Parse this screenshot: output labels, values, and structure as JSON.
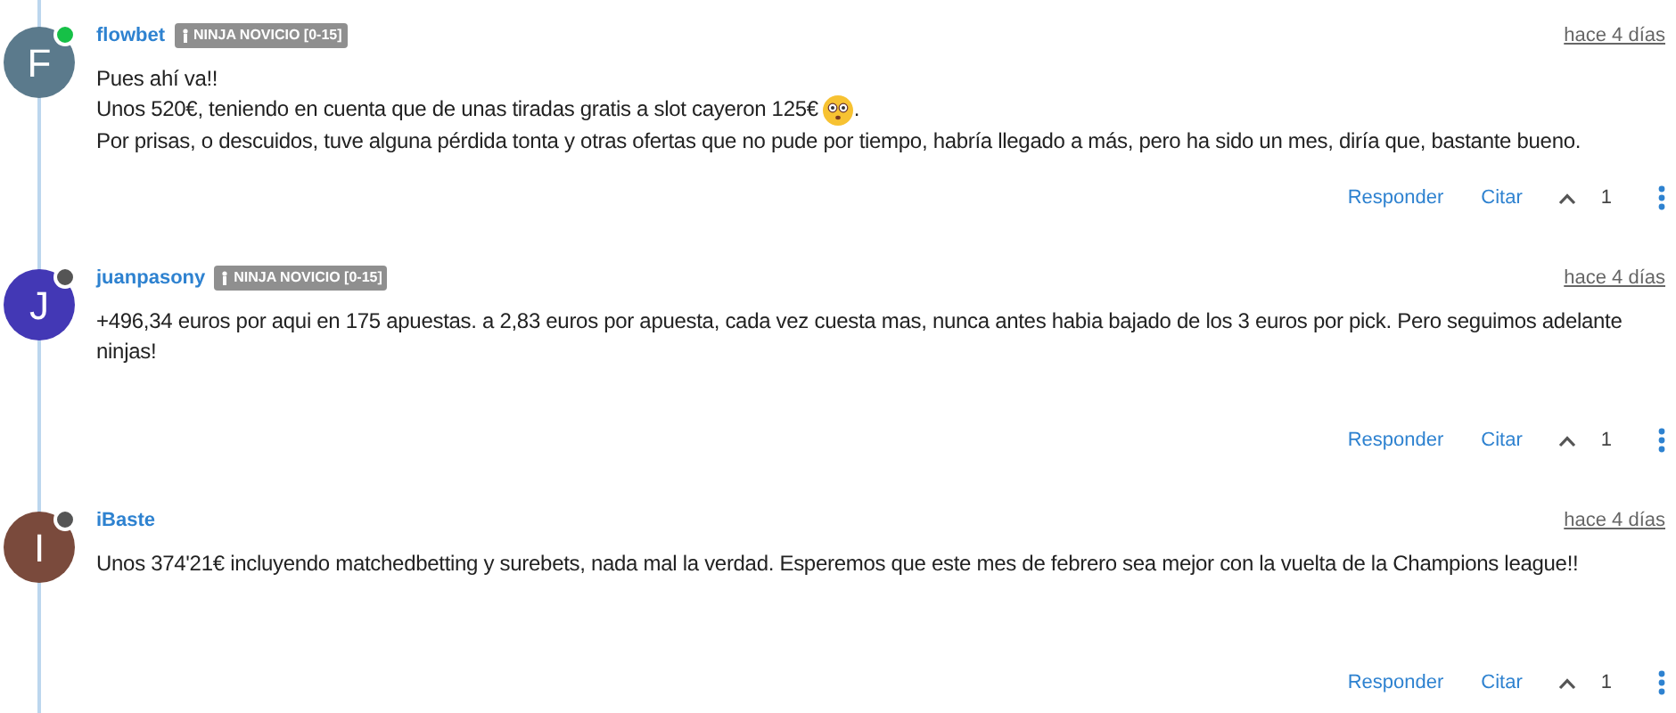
{
  "comments": [
    {
      "avatar_letter": "F",
      "color": "#5b7a8c",
      "online": true,
      "author": "flowbet",
      "badge": "NINJA NOVICIO [0-15]",
      "time": "hace 4 días",
      "lines": [
        "Pues ahí va!!",
        {
          "text": "Unos 520€, teniendo en cuenta que de unas tiradas gratis a slot cayeron 125€",
          "emoji": true,
          "after": "."
        },
        "Por prisas, o descuidos, tuve alguna pérdida tonta y otras ofertas que no pude por tiempo, habría llegado a más, pero ha sido un mes, diría que, bastante bueno."
      ],
      "reply": "Responder",
      "quote": "Citar",
      "votes": "1"
    },
    {
      "avatar_letter": "J",
      "color": "#4338b5",
      "online": false,
      "author": "juanpasony",
      "badge": "NINJA NOVICIO [0-15]",
      "time": "hace 4 días",
      "lines": [
        "+496,34 euros por aqui en 175 apuestas. a 2,83 euros por apuesta, cada vez cuesta mas, nunca antes habia bajado de los 3 euros por pick. Pero seguimos adelante ninjas!"
      ],
      "reply": "Responder",
      "quote": "Citar",
      "votes": "1"
    },
    {
      "avatar_letter": "I",
      "color": "#7a4a3c",
      "online": false,
      "author": "iBaste",
      "time": "hace 4 días",
      "lines": [
        "Unos 374'21€ incluyendo matchedbetting y surebets, nada mal la verdad. Esperemos que este mes de febrero sea mejor con la vuelta de la Champions league!!"
      ],
      "reply": "Responder",
      "quote": "Citar",
      "votes": "1"
    }
  ]
}
